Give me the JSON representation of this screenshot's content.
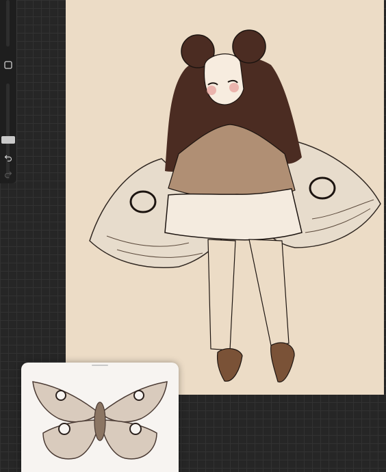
{
  "app": {
    "name": "drawing-app",
    "state": "canvas-with-reference"
  },
  "sidebar": {
    "brush_size_slider": {
      "level": 0.0
    },
    "modify_button": {
      "icon": "square-modify-icon"
    },
    "opacity_slider": {
      "level": 0.05
    },
    "undo_button": {
      "icon": "undo-arrow-icon"
    },
    "redo_button": {
      "icon": "redo-arrow-icon",
      "enabled": false
    }
  },
  "canvas": {
    "background_color": "#ecdcc6",
    "subject": "sketched-girl-moth-costume"
  },
  "reference_window": {
    "image": "moth-specimen-photo",
    "background_color": "#f7f4f1"
  },
  "colors": {
    "hair": "#4b2c22",
    "sweater": "#b08f74",
    "line": "#1c1410",
    "shoes": "#7a5237",
    "wing": "#e7dccd"
  }
}
